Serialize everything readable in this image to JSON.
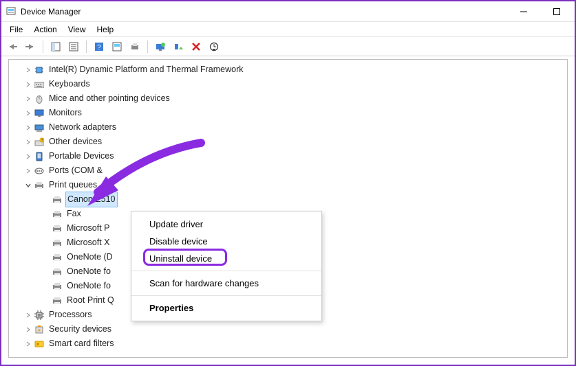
{
  "window": {
    "title": "Device Manager"
  },
  "menus": {
    "file": "File",
    "action": "Action",
    "view": "View",
    "help": "Help"
  },
  "tree": {
    "items": [
      "Intel(R) Dynamic Platform and Thermal Framework",
      "Keyboards",
      "Mice and other pointing devices",
      "Monitors",
      "Network adapters",
      "Other devices",
      "Portable Devices",
      "Ports (COM & "
    ],
    "print_queues": "Print queues",
    "printers": {
      "p0": "Canon E510",
      "p1": "Fax",
      "p2": "Microsoft P",
      "p3": "Microsoft X",
      "p4": "OneNote (D",
      "p5": "OneNote fo",
      "p6": "OneNote fo",
      "p7": "Root Print Q"
    },
    "after": {
      "a0": "Processors",
      "a1": "Security devices",
      "a2": "Smart card filters"
    }
  },
  "context_menu": {
    "update": "Update driver",
    "disable": "Disable device",
    "uninstall": "Uninstall device",
    "scan": "Scan for hardware changes",
    "properties": "Properties"
  }
}
